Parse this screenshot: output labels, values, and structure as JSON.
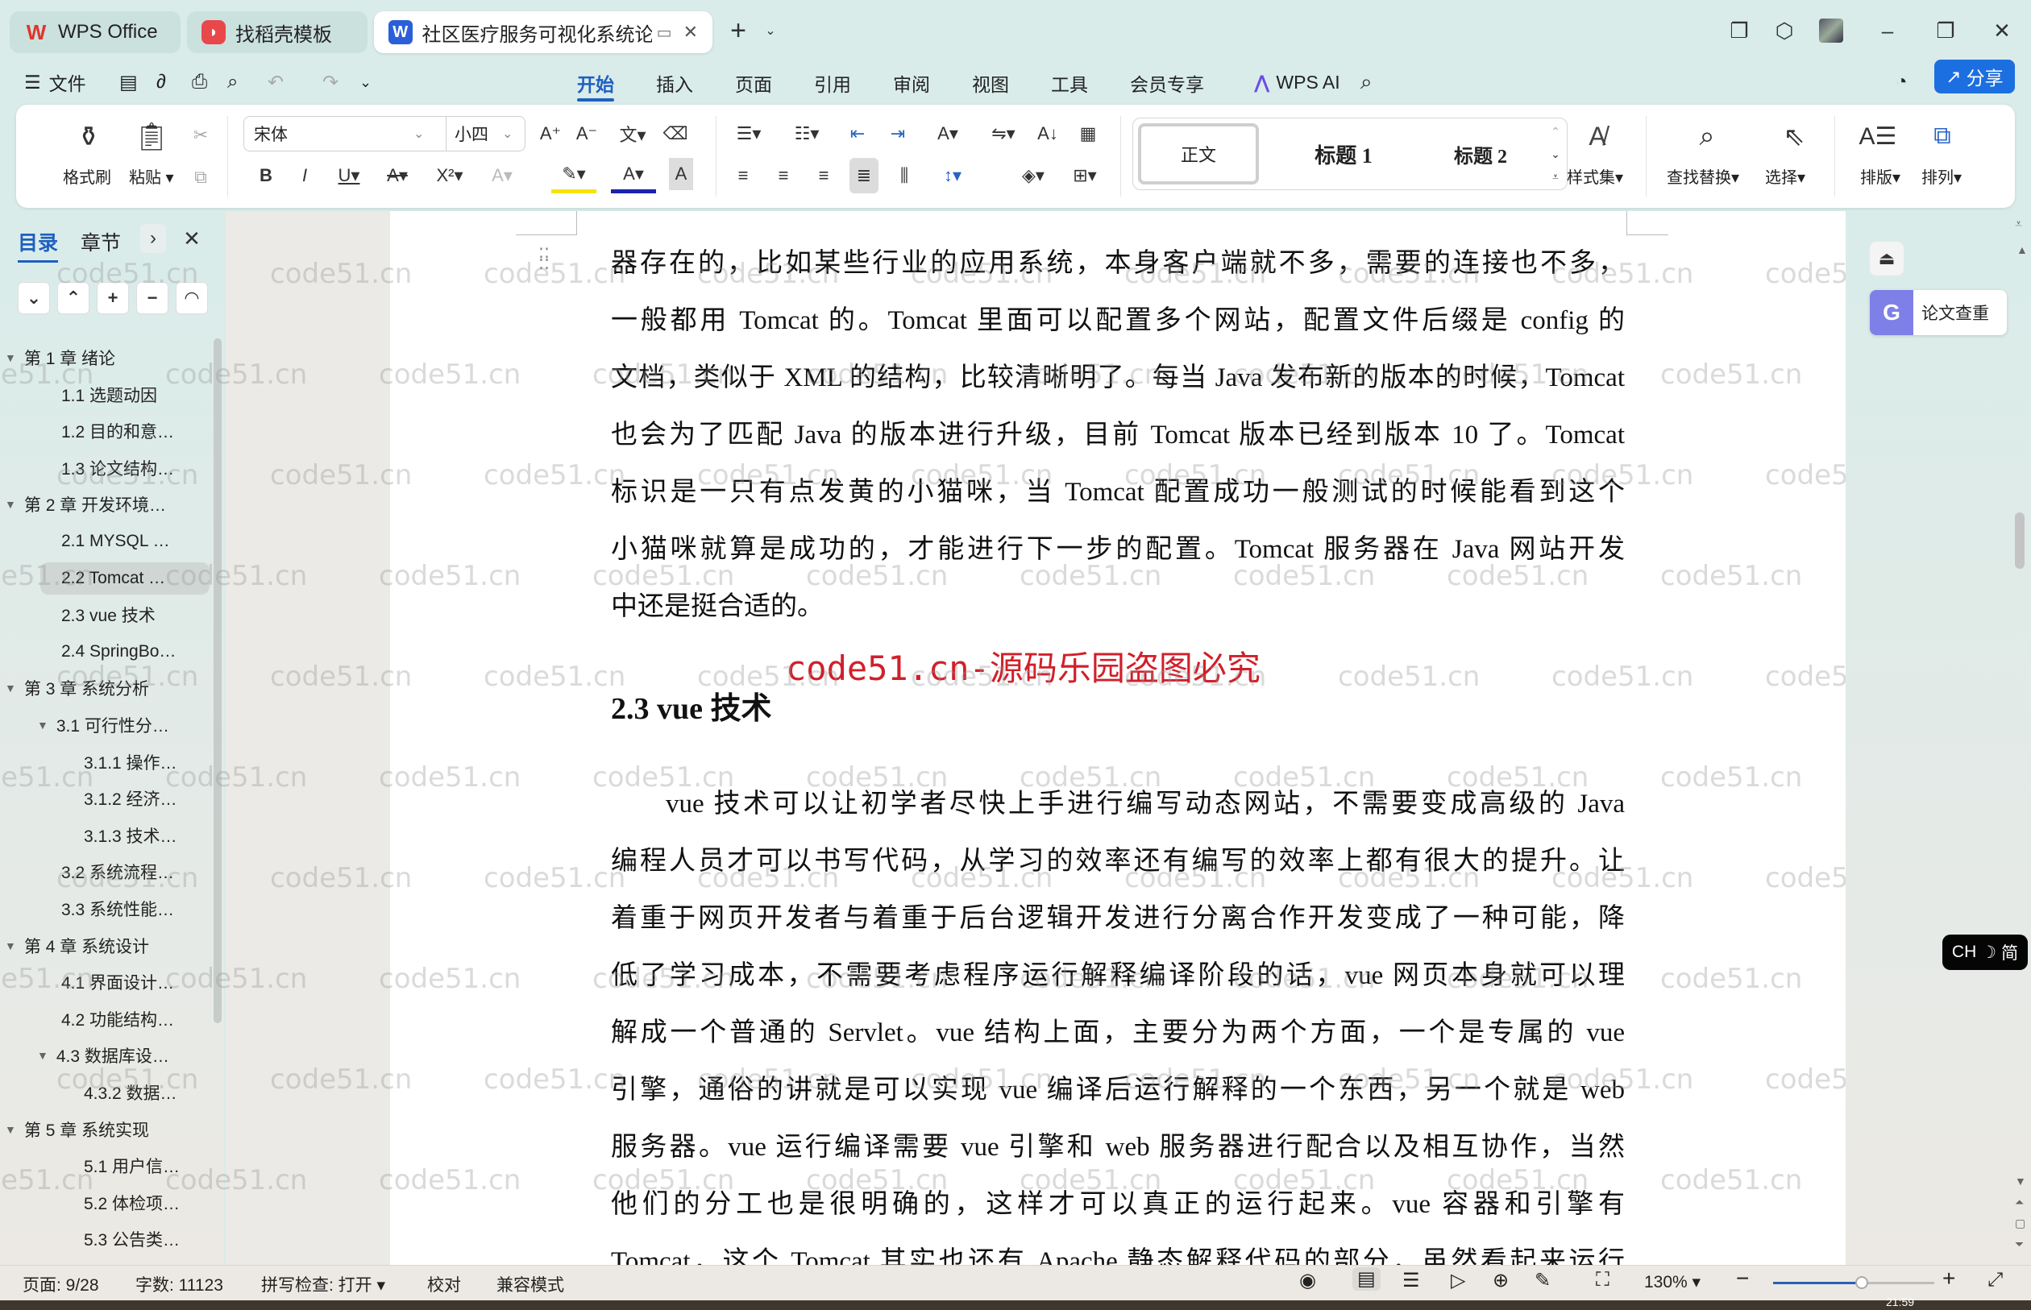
{
  "titlebar": {
    "tabs": [
      {
        "label": "WPS Office",
        "icon": "wps-logo-icon"
      },
      {
        "label": "找稻壳模板",
        "icon": "docer-icon"
      },
      {
        "label": "社区医疗服务可视化系统论文.c",
        "icon": "word-doc-icon",
        "active": true
      }
    ],
    "new_tab": "+",
    "window_controls": [
      "minimize",
      "maximize",
      "close"
    ]
  },
  "menubar": {
    "file_label": "文件",
    "tabs": [
      "开始",
      "插入",
      "页面",
      "引用",
      "审阅",
      "视图",
      "工具",
      "会员专享"
    ],
    "active_tab": "开始",
    "wps_ai_label": "WPS AI",
    "share_label": "分享"
  },
  "ribbon": {
    "format_painter_label": "格式刷",
    "paste_label": "粘贴",
    "font_name": "宋体",
    "font_size": "小四",
    "styles": [
      "正文",
      "标题 1",
      "标题 2"
    ],
    "style_set_label": "样式集",
    "find_replace_label": "查找替换",
    "select_label": "选择",
    "layout_label": "排版",
    "arrange_label": "排列",
    "accent_color": "#1f5fbf"
  },
  "left_panel": {
    "tabs": [
      "目录",
      "章节"
    ],
    "active_tab": "目录",
    "toc": [
      {
        "label": "第 1 章  绪论",
        "level": 1,
        "expanded": true
      },
      {
        "label": "1.1 选题动因",
        "level": 2
      },
      {
        "label": "1.2 目的和意…",
        "level": 2
      },
      {
        "label": "1.3 论文结构…",
        "level": 2
      },
      {
        "label": "第 2 章  开发环境…",
        "level": 1,
        "expanded": true
      },
      {
        "label": "2.1 MYSQL …",
        "level": 2
      },
      {
        "label": "2.2 Tomcat  …",
        "level": 2,
        "selected": true
      },
      {
        "label": "2.3 vue 技术",
        "level": 2
      },
      {
        "label": "2.4 SpringBo…",
        "level": 2
      },
      {
        "label": "第 3 章  系统分析",
        "level": 1,
        "expanded": true
      },
      {
        "label": "3.1 可行性分…",
        "level": 2,
        "expanded": true
      },
      {
        "label": "3.1.1 操作…",
        "level": 3
      },
      {
        "label": "3.1.2 经济…",
        "level": 3
      },
      {
        "label": "3.1.3 技术…",
        "level": 3
      },
      {
        "label": "3.2 系统流程…",
        "level": 2
      },
      {
        "label": "3.3 系统性能…",
        "level": 2
      },
      {
        "label": "第 4 章  系统设计",
        "level": 1,
        "expanded": true
      },
      {
        "label": "4.1 界面设计…",
        "level": 2
      },
      {
        "label": "4.2 功能结构…",
        "level": 2
      },
      {
        "label": "4.3 数据库设…",
        "level": 2,
        "expanded": true
      },
      {
        "label": "4.3.2 数据…",
        "level": 3
      },
      {
        "label": "第 5 章  系统实现",
        "level": 1,
        "expanded": true
      },
      {
        "label": "5.1 用户信…",
        "level": 3
      },
      {
        "label": "5.2  体检项…",
        "level": 3
      },
      {
        "label": "5.3 公告类…",
        "level": 3
      }
    ]
  },
  "document": {
    "lines_top": [
      "器存在的，比如某些行业的应用系统，本身客户端就不多，需要的连接也不多，",
      "一般都用 Tomcat 的。Tomcat 里面可以配置多个网站，配置文件后缀是 config 的",
      "文档，类似于 XML 的结构，比较清晰明了。每当 Java 发布新的版本的时候，Tomcat",
      "也会为了匹配 Java 的版本进行升级，目前 Tomcat 版本已经到版本 10 了。Tomcat",
      "标识是一只有点发黄的小猫咪，当 Tomcat 配置成功一般测试的时候能看到这个",
      "小猫咪就算是成功的，才能进行下一步的配置。Tomcat 服务器在 Java 网站开发",
      "中还是挺合适的。"
    ],
    "watermark_notice": "code51.cn-源码乐园盗图必究",
    "heading": "2.3 vue 技术",
    "lines_bottom": [
      "vue 技术可以让初学者尽快上手进行编写动态网站，不需要变成高级的 Java",
      "编程人员才可以书写代码，从学习的效率还有编写的效率上都有很大的提升。让",
      "着重于网页开发者与着重于后台逻辑开发进行分离合作开发变成了一种可能，降",
      "低了学习成本，不需要考虑程序运行解释编译阶段的话，vue 网页本身就可以理",
      "解成一个普通的 Servlet。vue 结构上面，主要分为两个方面，一个是专属的 vue",
      "引擎，通俗的讲就是可以实现 vue 编译后运行解释的一个东西，另一个就是 web",
      "服务器。vue 运行编译需要 vue 引擎和 web 服务器进行配合以及相互协作，当然",
      "他们的分工也是很明确的，这样才可以真正的运行起来。vue 容器和引擎有",
      "Tomcat，这个 Tomcat 其实也还有 Apache 静态解释代码的部分，虽然看起来运行"
    ],
    "watermark_text": "code51.cn"
  },
  "right_panel": {
    "plagiarism_check_label": "论文查重",
    "ime_label": "CH",
    "ime_mode": "简"
  },
  "statusbar": {
    "page": "页面: 9/28",
    "word_count": "字数: 11123",
    "spell_check": "拼写检查: 打开",
    "proofread": "校对",
    "compat_mode": "兼容模式",
    "zoom": "130%",
    "zoom_slider_fraction": 0.55,
    "clock": "21:59"
  }
}
